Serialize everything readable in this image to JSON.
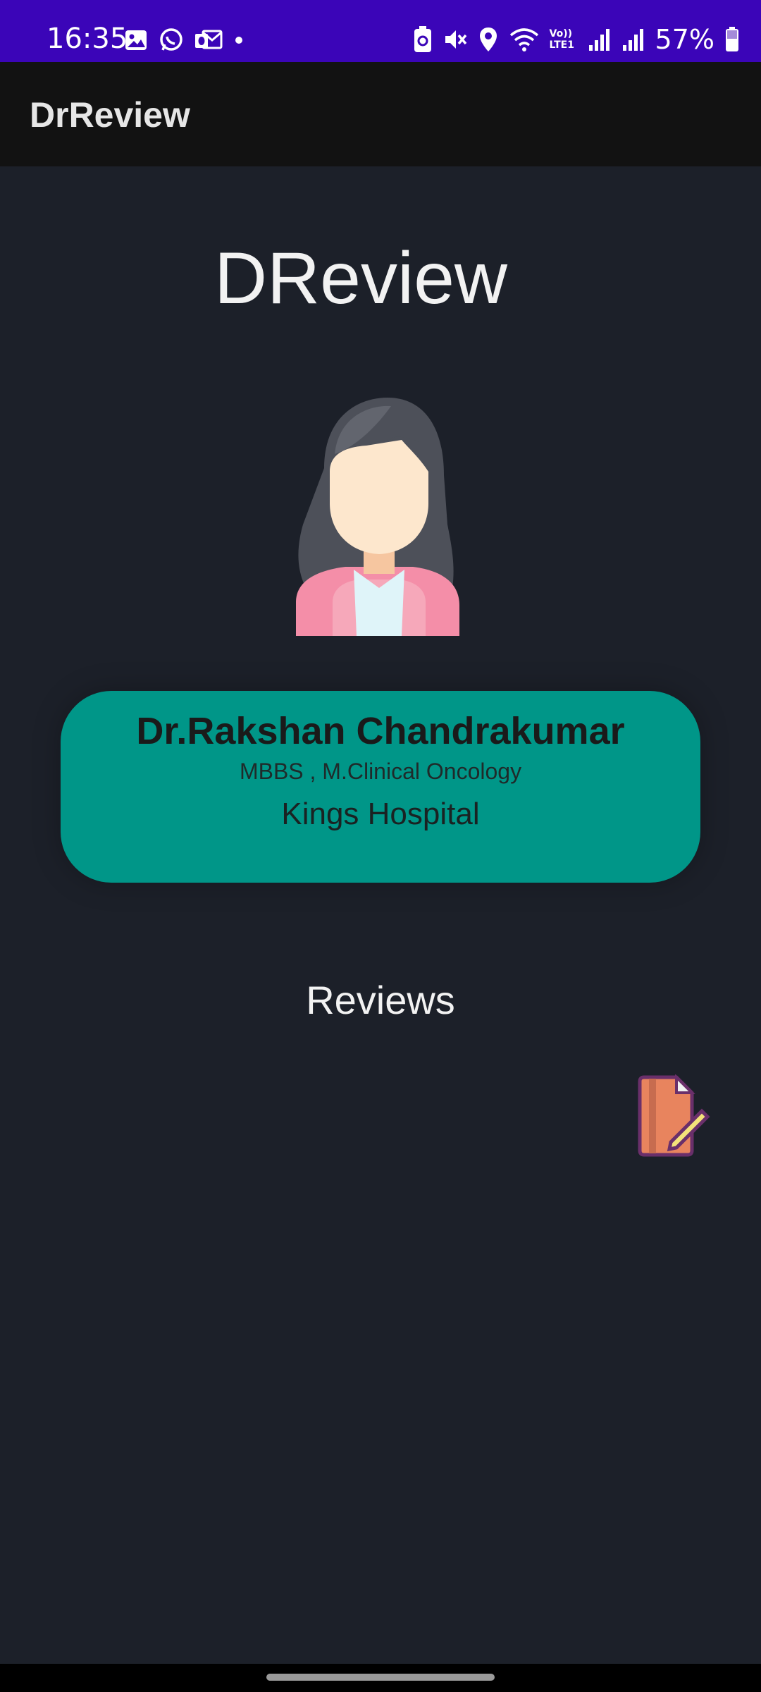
{
  "status_bar": {
    "time": "16:35",
    "battery": "57%",
    "network_label": "Vo)) LTE1",
    "left_icons": [
      "gallery-icon",
      "whatsapp-icon",
      "outlook-icon",
      "dot-icon"
    ],
    "right_icons": [
      "battery-saver-icon",
      "mute-icon",
      "location-icon",
      "wifi-icon",
      "signal-icon",
      "signal-icon",
      "battery-icon"
    ]
  },
  "app_bar": {
    "title": "DrReview"
  },
  "main": {
    "heading": "DReview",
    "doctor": {
      "name": "Dr.Rakshan Chandrakumar",
      "degree": "MBBS , M.Clinical Oncology",
      "hospital": "Kings Hospital"
    },
    "reviews_heading": "Reviews"
  },
  "colors": {
    "status_bar": "#3b05b8",
    "app_bar": "#121212",
    "background": "#1c2029",
    "card": "#009688"
  }
}
